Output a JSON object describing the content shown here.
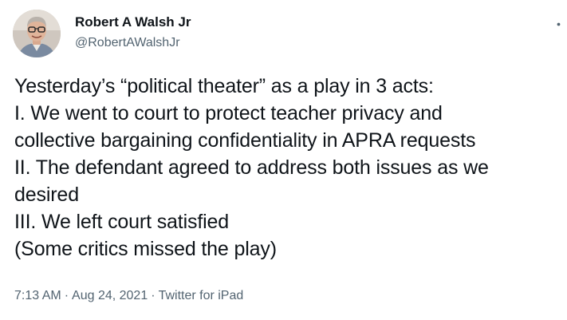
{
  "author": {
    "display_name": "Robert A Walsh Jr",
    "handle": "@RobertAWalshJr",
    "avatar_icon": "profile-photo"
  },
  "menu": {
    "icon": "more-options-icon"
  },
  "tweet": {
    "lines": [
      "Yesterday’s “political theater” as a play in 3 acts:",
      "I. We went to court to protect teacher privacy and",
      "collective bargaining confidentiality in APRA requests",
      "II. The defendant agreed to address both issues as we",
      "desired",
      "III. We left court satisfied",
      "(Some critics missed the play)"
    ]
  },
  "meta": {
    "time": "7:13 AM",
    "separator": "·",
    "date": "Aug 24, 2021",
    "source": "Twitter for iPad"
  },
  "colors": {
    "text_primary": "#0f1419",
    "text_secondary": "#536471",
    "background": "#ffffff"
  }
}
